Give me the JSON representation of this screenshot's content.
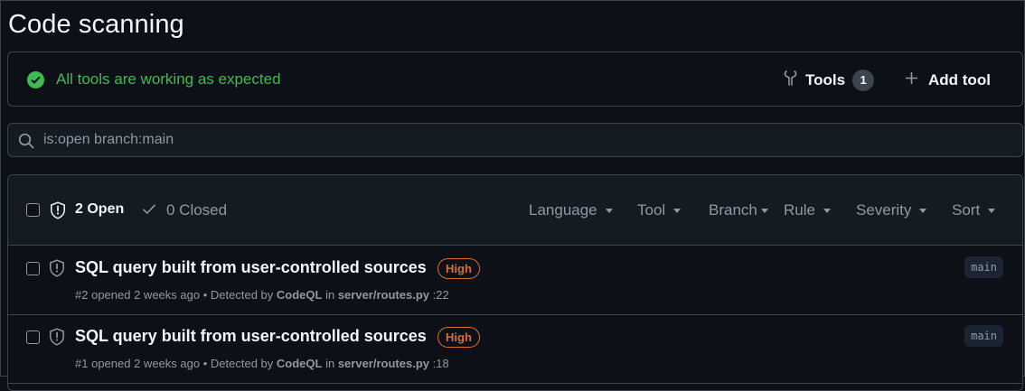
{
  "page": {
    "title": "Code scanning"
  },
  "status": {
    "text": "All tools are working as expected",
    "color": "#3fb950",
    "icon": "check-circle-icon"
  },
  "actions": {
    "tools_label": "Tools",
    "tools_count": "1",
    "add_tool_label": "Add tool"
  },
  "search": {
    "value": "is:open branch:main"
  },
  "list_header": {
    "open_label": "2 Open",
    "closed_label": "0 Closed",
    "filters": [
      "Language",
      "Tool",
      "Branch",
      "Rule",
      "Severity",
      "Sort"
    ]
  },
  "alerts": [
    {
      "title": "SQL query built from user-controlled sources",
      "severity": "High",
      "number": "#2",
      "opened": "opened 2 weeks ago",
      "detected_by_prefix": "Detected by",
      "tool": "CodeQL",
      "in_word": "in",
      "path": "server/routes.py",
      "line": ":22",
      "branch": "main"
    },
    {
      "title": "SQL query built from user-controlled sources",
      "severity": "High",
      "number": "#1",
      "opened": "opened 2 weeks ago",
      "detected_by_prefix": "Detected by",
      "tool": "CodeQL",
      "in_word": "in",
      "path": "server/routes.py",
      "line": ":18",
      "branch": "main"
    }
  ],
  "colors": {
    "background": "#0d1117",
    "border": "#3d444d",
    "severity_high": "#db6d28",
    "success": "#3fb950"
  }
}
